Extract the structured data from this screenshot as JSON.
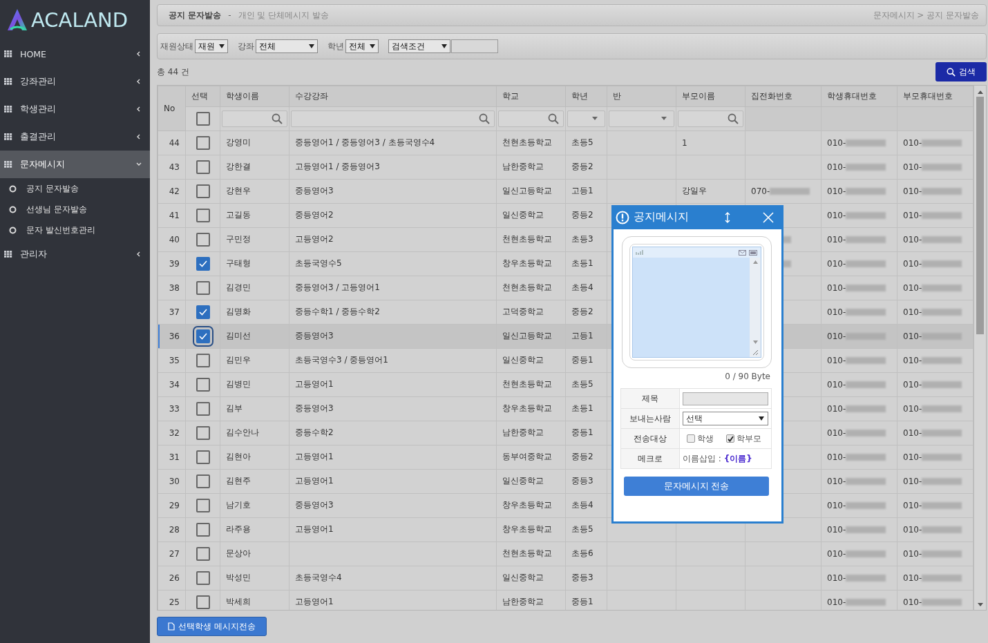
{
  "sidebar": {
    "logo": "ACALAND",
    "menu": [
      {
        "label": "HOME",
        "expanded": false,
        "selected": false
      },
      {
        "label": "강좌관리",
        "expanded": false,
        "selected": false
      },
      {
        "label": "학생관리",
        "expanded": false,
        "selected": false
      },
      {
        "label": "출결관리",
        "expanded": false,
        "selected": false
      },
      {
        "label": "문자메시지",
        "expanded": true,
        "selected": true,
        "children": [
          {
            "label": "공지 문자발송"
          },
          {
            "label": "선생님 문자발송"
          },
          {
            "label": "문자 발신번호관리"
          }
        ]
      },
      {
        "label": "관리자",
        "expanded": false,
        "selected": false
      }
    ]
  },
  "page_header": {
    "title": "공지 문자발송",
    "separator": "-",
    "subtitle": "개인 및 단체메시지 발송",
    "breadcrumb": "문자메시지 > 공지 문자발송"
  },
  "filters": [
    {
      "label": "재원상태",
      "value": "재원",
      "kind": "short"
    },
    {
      "label": "강좌",
      "value": "전체",
      "kind": "long"
    },
    {
      "label": "학년",
      "value": "전체",
      "kind": "short"
    },
    {
      "value": "검색조건",
      "kind": "long"
    }
  ],
  "total": "총 44 건",
  "search_button": "검색",
  "table": {
    "select_all": {
      "checked": false
    },
    "columns": [
      {
        "label": "No",
        "kind": "span"
      },
      {
        "label": "선택",
        "kind": "checkbox"
      },
      {
        "label": "학생이름",
        "kind": "search"
      },
      {
        "label": "수강강좌",
        "kind": "search"
      },
      {
        "label": "학교",
        "kind": "search"
      },
      {
        "label": "학년",
        "kind": "select"
      },
      {
        "label": "반",
        "kind": "select"
      },
      {
        "label": "부모이름",
        "kind": "search"
      },
      {
        "label": "집전화번호",
        "kind": "plain"
      },
      {
        "label": "학생휴대번호",
        "kind": "plain"
      },
      {
        "label": "부모휴대번호",
        "kind": "plain"
      }
    ],
    "rows": [
      {
        "no": "44",
        "checked": false,
        "selected": false,
        "name": "강영미",
        "courses": "중등영어1 / 중등영어3 / 초등국영수4",
        "school": "천현초등학교",
        "grade": "초등5",
        "parent": "1",
        "student_phone": "010-",
        "parent_phone": "010-"
      },
      {
        "no": "43",
        "checked": false,
        "selected": false,
        "name": "강한결",
        "courses": "고등영어1 / 중등영어3",
        "school": "남한중학교",
        "grade": "중등2",
        "student_phone": "010-",
        "parent_phone": "010-"
      },
      {
        "no": "42",
        "checked": false,
        "selected": false,
        "name": "강현우",
        "courses": "중등영어3",
        "school": "일신고등학교",
        "grade": "고등1",
        "parent": "강일우",
        "home": "070-",
        "student_phone": "010-",
        "parent_phone": "010-"
      },
      {
        "no": "41",
        "checked": false,
        "selected": false,
        "name": "고길동",
        "courses": "중등영어2",
        "school": "일신중학교",
        "grade": "중등2",
        "student_phone": "010-",
        "parent_phone": "010-"
      },
      {
        "no": "40",
        "checked": false,
        "selected": false,
        "name": "구민정",
        "courses": "고등영어2",
        "school": "천현초등학교",
        "grade": "초등3",
        "home_blur": true,
        "student_phone": "010-",
        "parent_phone": "010-"
      },
      {
        "no": "39",
        "checked": true,
        "selected": false,
        "name": "구태형",
        "courses": "초등국영수5",
        "school": "창우초등학교",
        "grade": "초등1",
        "home_blur": true,
        "student_phone": "010-",
        "parent_phone": "010-"
      },
      {
        "no": "38",
        "checked": false,
        "selected": false,
        "name": "김경민",
        "courses": "중등영어3 / 고등영어1",
        "school": "천현초등학교",
        "grade": "초등4",
        "student_phone": "010-",
        "parent_phone": "010-"
      },
      {
        "no": "37",
        "checked": true,
        "selected": false,
        "name": "김명화",
        "courses": "중등수학1 / 중등수학2",
        "school": "고덕중학교",
        "grade": "중등2",
        "student_phone": "010-",
        "parent_phone": "010-"
      },
      {
        "no": "36",
        "checked": true,
        "selected": true,
        "name": "김미선",
        "courses": "중등영어3",
        "school": "일신고등학교",
        "grade": "고등1",
        "student_phone": "010-",
        "parent_phone": "010-"
      },
      {
        "no": "35",
        "checked": false,
        "selected": false,
        "name": "김민우",
        "courses": "초등국영수3 / 중등영어1",
        "school": "일신중학교",
        "grade": "중등1",
        "student_phone": "010-",
        "parent_phone": "010-"
      },
      {
        "no": "34",
        "checked": false,
        "selected": false,
        "name": "김병민",
        "courses": "고등영어1",
        "school": "천현초등학교",
        "grade": "초등5",
        "student_phone": "010-",
        "parent_phone": "010-"
      },
      {
        "no": "33",
        "checked": false,
        "selected": false,
        "name": "김부",
        "courses": "중등영어3",
        "school": "창우초등학교",
        "grade": "초등1",
        "student_phone": "010-",
        "parent_phone": "010-"
      },
      {
        "no": "32",
        "checked": false,
        "selected": false,
        "name": "김수안나",
        "courses": "중등수학2",
        "school": "남한중학교",
        "grade": "중등1",
        "student_phone": "010-",
        "parent_phone": "010-"
      },
      {
        "no": "31",
        "checked": false,
        "selected": false,
        "name": "김현아",
        "courses": "고등영어1",
        "school": "동부여중학교",
        "grade": "중등2",
        "student_phone": "010-",
        "parent_phone": "010-"
      },
      {
        "no": "30",
        "checked": false,
        "selected": false,
        "name": "김현주",
        "courses": "고등영어1",
        "school": "일신중학교",
        "grade": "중등3",
        "student_phone": "010-",
        "parent_phone": "010-"
      },
      {
        "no": "29",
        "checked": false,
        "selected": false,
        "name": "남기호",
        "courses": "중등영어3",
        "school": "창우초등학교",
        "grade": "초등4",
        "student_phone": "010-",
        "parent_phone": "010-"
      },
      {
        "no": "28",
        "checked": false,
        "selected": false,
        "name": "라주용",
        "courses": "고등영어1",
        "school": "창우초등학교",
        "grade": "초등5",
        "student_phone": "010-",
        "parent_phone": "010-"
      },
      {
        "no": "27",
        "checked": false,
        "selected": false,
        "name": "문상아",
        "school": "천현초등학교",
        "grade": "초등6",
        "student_phone": "010-",
        "parent_phone": "010-"
      },
      {
        "no": "26",
        "checked": false,
        "selected": false,
        "name": "박성민",
        "courses": "초등국영수4",
        "school": "일신중학교",
        "grade": "중등3",
        "student_phone": "010-",
        "parent_phone": "010-"
      },
      {
        "no": "25",
        "checked": false,
        "selected": false,
        "name": "박세희",
        "courses": "고등영어1",
        "school": "남한중학교",
        "grade": "중등1",
        "student_phone": "010-",
        "parent_phone": "010-"
      }
    ]
  },
  "bulk_button": "선택학생 메시지전송",
  "dialog": {
    "title": "공지메시지",
    "counter": "0 / 90 Byte",
    "fields": [
      {
        "label": "제목",
        "kind": "text"
      },
      {
        "label": "보내는사람",
        "kind": "select",
        "value": "선택"
      },
      {
        "label": "전송대상",
        "kind": "checks",
        "options": [
          {
            "label": "학생",
            "checked": false
          },
          {
            "label": "학부모",
            "checked": true
          }
        ]
      },
      {
        "label": "메크로",
        "kind": "macro",
        "text": "이름삽입 : ",
        "token": "{이름}"
      }
    ],
    "send_button": "문자메시지 전송"
  }
}
